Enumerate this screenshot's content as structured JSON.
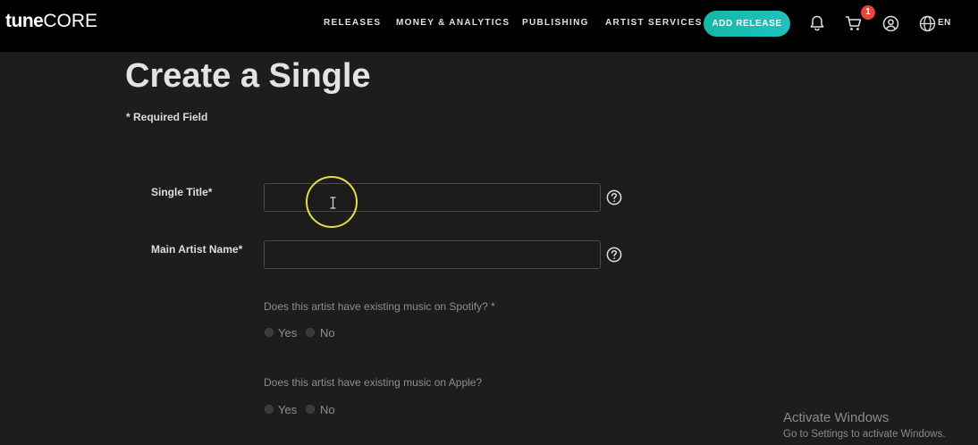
{
  "brand": {
    "logo_bold": "tune",
    "logo_light": "CORE"
  },
  "nav": {
    "items": [
      {
        "label": "RELEASES"
      },
      {
        "label": "MONEY & ANALYTICS"
      },
      {
        "label": "PUBLISHING"
      },
      {
        "label": "ARTIST SERVICES"
      }
    ],
    "add_release_label": "ADD RELEASE",
    "cart_count": "1",
    "language": "EN",
    "icons": [
      "bell-icon",
      "cart-icon",
      "user-icon",
      "globe-icon"
    ]
  },
  "page": {
    "title": "Create a Single",
    "required_note": "* Required Field"
  },
  "form": {
    "single_title": {
      "label": "Single Title*",
      "value": "",
      "placeholder": ""
    },
    "main_artist": {
      "label": "Main Artist Name*",
      "value": "",
      "placeholder": ""
    },
    "spotify_question": {
      "text": "Does this artist have existing music on Spotify? *",
      "options": [
        "Yes",
        "No"
      ]
    },
    "apple_question": {
      "text": "Does this artist have existing music on Apple?",
      "options": [
        "Yes",
        "No"
      ]
    }
  },
  "watermark": {
    "title": "Activate Windows",
    "subtitle": "Go to Settings to activate Windows."
  },
  "colors": {
    "background": "#1e1d1d",
    "topbar": "#000000",
    "accent": "#1abcb0",
    "badge": "#e9463a",
    "cursor_highlight": "#e4dd47"
  }
}
